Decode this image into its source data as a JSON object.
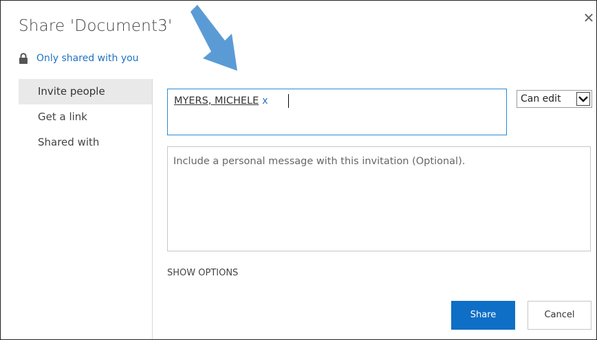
{
  "dialog": {
    "title": "Share 'Document3'",
    "close_glyph": "✕",
    "status_text": "Only shared with you",
    "icons": {
      "close": "close-icon",
      "lock": "lock-icon",
      "arrow": "arrow-pointer-icon",
      "dropdown": "chevron-down-icon"
    }
  },
  "nav": {
    "items": [
      {
        "label": "Invite people",
        "selected": true
      },
      {
        "label": "Get a link",
        "selected": false
      },
      {
        "label": "Shared with",
        "selected": false
      }
    ]
  },
  "invite": {
    "recipient": "MYERS, MICHELE",
    "remove_label": "x",
    "permission": "Can edit",
    "message_placeholder": "Include a personal message with this invitation (Optional).",
    "show_options": "SHOW OPTIONS"
  },
  "actions": {
    "share": "Share",
    "cancel": "Cancel"
  },
  "colors": {
    "accent": "#0f6ec6",
    "link": "#1f73c2",
    "arrow": "#5b9bd5"
  }
}
